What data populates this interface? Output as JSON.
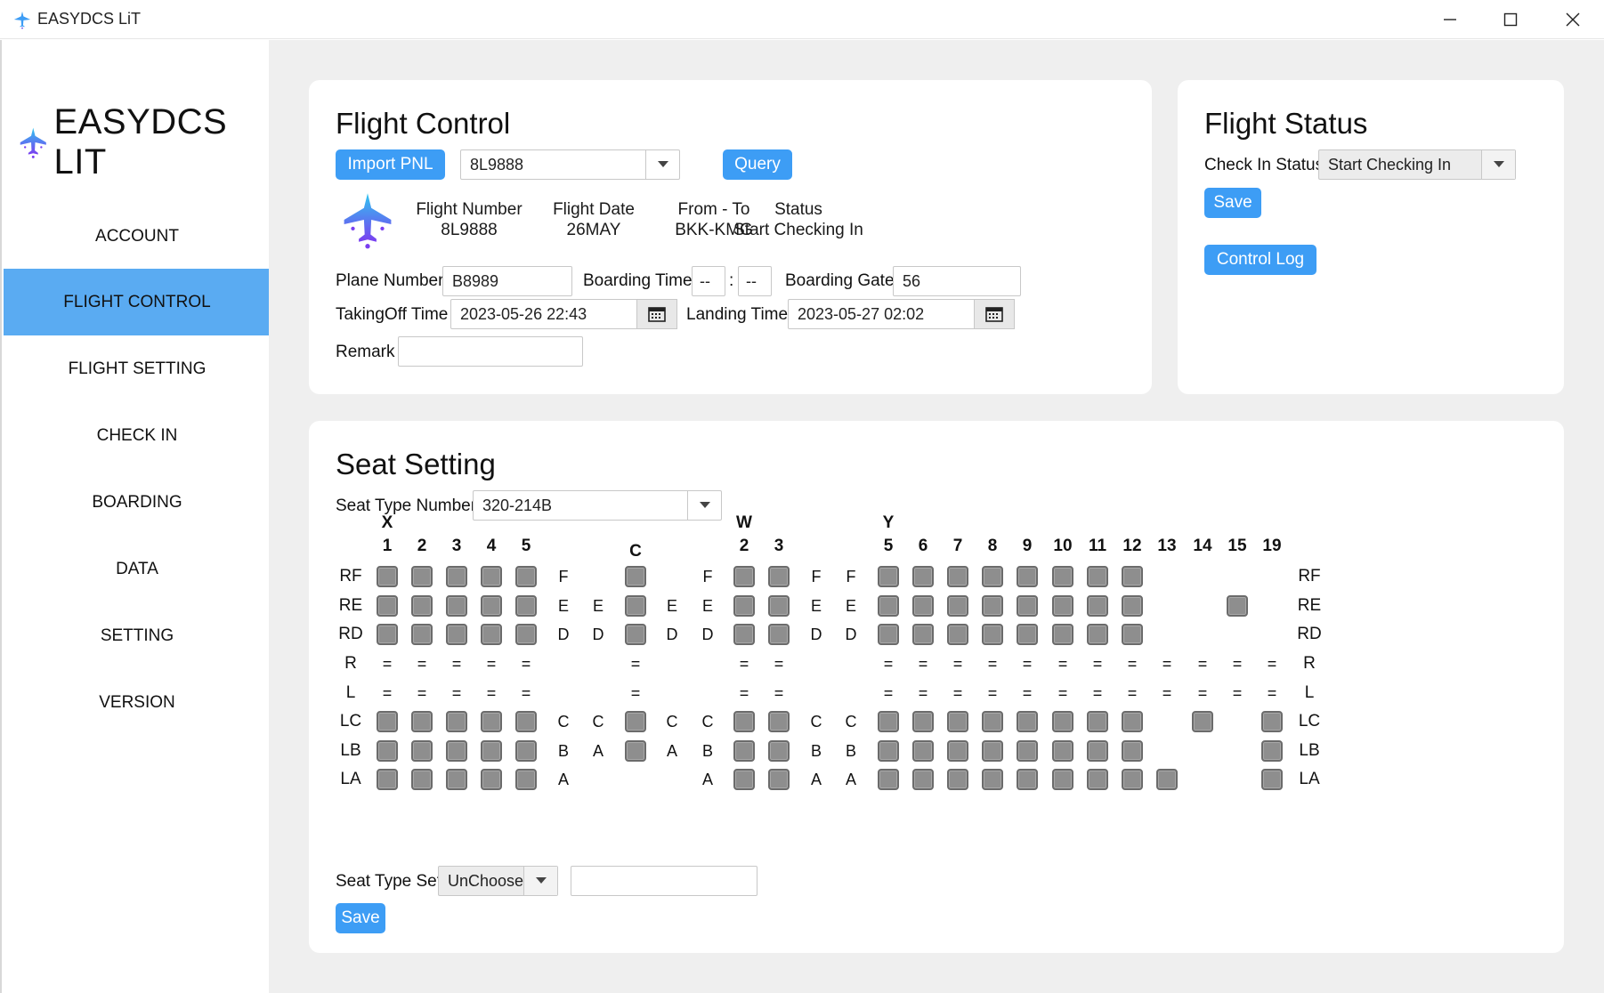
{
  "window": {
    "title": "EASYDCS LiT"
  },
  "sidebar": {
    "brand": "EASYDCS LIT",
    "items": [
      {
        "label": "ACCOUNT",
        "active": false
      },
      {
        "label": "FLIGHT CONTROL",
        "active": true
      },
      {
        "label": "FLIGHT SETTING",
        "active": false
      },
      {
        "label": "CHECK IN",
        "active": false
      },
      {
        "label": "BOARDING",
        "active": false
      },
      {
        "label": "DATA",
        "active": false
      },
      {
        "label": "SETTING",
        "active": false
      },
      {
        "label": "VERSION",
        "active": false
      }
    ]
  },
  "flight_control": {
    "title": "Flight Control",
    "import_label": "Import PNL",
    "flight_select": "8L9888",
    "query_label": "Query",
    "info": {
      "flight_number_label": "Flight Number",
      "flight_number": "8L9888",
      "flight_date_label": "Flight Date",
      "flight_date": "26MAY",
      "from_to_label": "From - To",
      "from_to": "BKK-KMG",
      "status_label": "Status",
      "status": "Start Checking In"
    },
    "plane_number_label": "Plane Number",
    "plane_number": "B8989",
    "boarding_time_label": "Boarding Time",
    "boarding_hour": "--",
    "boarding_sep": ":",
    "boarding_min": "--",
    "boarding_gate_label": "Boarding Gate",
    "boarding_gate": "56",
    "takeoff_label": "TakingOff Time",
    "takeoff_time": "2023-05-26 22:43",
    "landing_label": "Landing Time",
    "landing_time": "2023-05-27 02:02",
    "remark_label": "Remark",
    "remark": ""
  },
  "flight_status": {
    "title": "Flight Status",
    "check_in_label": "Check In Status",
    "check_in_value": "Start Checking In",
    "save_label": "Save",
    "control_log_label": "Control Log"
  },
  "seat_setting": {
    "title": "Seat Setting",
    "seat_type_number_label": "Seat Type Number",
    "seat_type_number": "320-214B",
    "seat_type_set_label": "Seat Type Set",
    "seat_type_set_value": "UnChoose",
    "seat_type_set_input": "",
    "save_label": "Save",
    "class_labels": [
      {
        "col": 0,
        "text": "X"
      },
      {
        "col": 7,
        "text": "C"
      },
      {
        "col": 10,
        "text": "W"
      },
      {
        "col": 14,
        "text": "Y"
      }
    ],
    "col_numbers": [
      "1",
      "2",
      "3",
      "4",
      "5",
      "",
      "",
      "1",
      "",
      "",
      "2",
      "3",
      "",
      "",
      "5",
      "6",
      "7",
      "8",
      "9",
      "10",
      "11",
      "12",
      "13",
      "14",
      "15",
      "19"
    ],
    "rows": [
      {
        "left": "RF",
        "right": "RF",
        "cells": [
          "S",
          "S",
          "S",
          "S",
          "S",
          "F",
          "",
          "S",
          "",
          "F",
          "S",
          "S",
          "F",
          "F",
          "S",
          "S",
          "S",
          "S",
          "S",
          "S",
          "S",
          "S",
          "",
          "",
          "",
          ""
        ]
      },
      {
        "left": "RE",
        "right": "RE",
        "cells": [
          "S",
          "S",
          "S",
          "S",
          "S",
          "E",
          "E",
          "S",
          "E",
          "E",
          "S",
          "S",
          "E",
          "E",
          "S",
          "S",
          "S",
          "S",
          "S",
          "S",
          "S",
          "S",
          "",
          "",
          "S",
          ""
        ]
      },
      {
        "left": "RD",
        "right": "RD",
        "cells": [
          "S",
          "S",
          "S",
          "S",
          "S",
          "D",
          "D",
          "S",
          "D",
          "D",
          "S",
          "S",
          "D",
          "D",
          "S",
          "S",
          "S",
          "S",
          "S",
          "S",
          "S",
          "S",
          "",
          "",
          "",
          ""
        ]
      },
      {
        "left": "R",
        "right": "R",
        "cells": [
          "=",
          "=",
          "=",
          "=",
          "=",
          "",
          "",
          "=",
          "",
          "",
          "=",
          "=",
          "",
          "",
          "=",
          "=",
          "=",
          "=",
          "=",
          "=",
          "=",
          "=",
          "=",
          "=",
          "=",
          "="
        ]
      },
      {
        "left": "L",
        "right": "L",
        "cells": [
          "=",
          "=",
          "=",
          "=",
          "=",
          "",
          "",
          "=",
          "",
          "",
          "=",
          "=",
          "",
          "",
          "=",
          "=",
          "=",
          "=",
          "=",
          "=",
          "=",
          "=",
          "=",
          "=",
          "=",
          "="
        ]
      },
      {
        "left": "LC",
        "right": "LC",
        "cells": [
          "S",
          "S",
          "S",
          "S",
          "S",
          "C",
          "C",
          "S",
          "C",
          "C",
          "S",
          "S",
          "C",
          "C",
          "S",
          "S",
          "S",
          "S",
          "S",
          "S",
          "S",
          "S",
          "",
          "S",
          "",
          "S"
        ]
      },
      {
        "left": "LB",
        "right": "LB",
        "cells": [
          "S",
          "S",
          "S",
          "S",
          "S",
          "B",
          "A",
          "S",
          "A",
          "B",
          "S",
          "S",
          "B",
          "B",
          "S",
          "S",
          "S",
          "S",
          "S",
          "S",
          "S",
          "S",
          "",
          "",
          "",
          "S"
        ]
      },
      {
        "left": "LA",
        "right": "LA",
        "cells": [
          "S",
          "S",
          "S",
          "S",
          "S",
          "A",
          "",
          "",
          "",
          "A",
          "S",
          "S",
          "A",
          "A",
          "S",
          "S",
          "S",
          "S",
          "S",
          "S",
          "S",
          "S",
          "S",
          "",
          "",
          "S"
        ]
      }
    ]
  },
  "colors": {
    "accent": "#3d9df5",
    "nav_active": "#5aabf2",
    "content_bg": "#efefef",
    "seat": "#8e8e8e"
  },
  "icons": {
    "app": "airplane-icon",
    "dropdown": "chevron-down-icon",
    "calendar": "calendar-icon"
  }
}
